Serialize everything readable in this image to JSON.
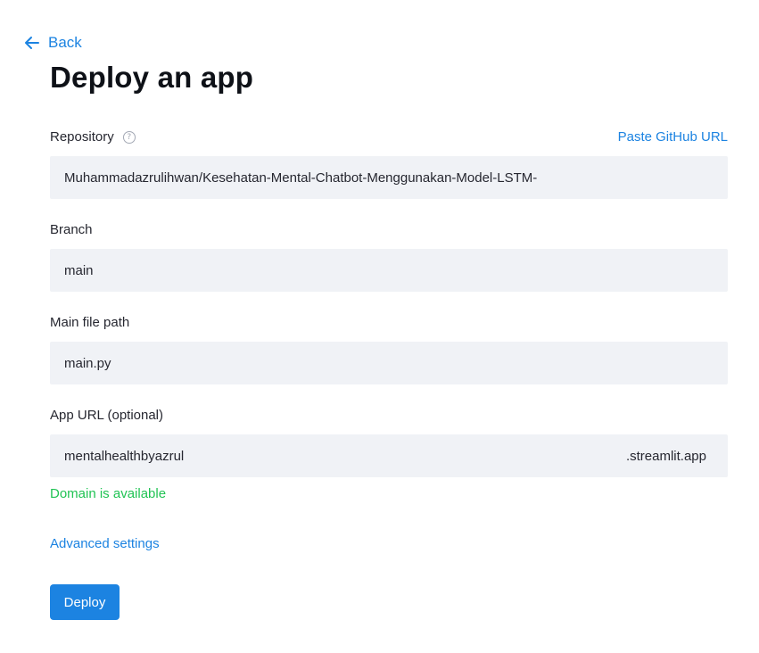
{
  "nav": {
    "back_label": "Back"
  },
  "page": {
    "title": "Deploy an app"
  },
  "repository": {
    "label": "Repository",
    "help_icon": "question-circle-icon",
    "paste_link": "Paste GitHub URL",
    "value": "Muhammadazrulihwan/Kesehatan-Mental-Chatbot-Menggunakan-Model-LSTM-"
  },
  "branch": {
    "label": "Branch",
    "value": "main"
  },
  "main_file": {
    "label": "Main file path",
    "value": "main.py"
  },
  "app_url": {
    "label": "App URL (optional)",
    "value": "mentalhealthbyazrul",
    "suffix": ".streamlit.app",
    "status": "Domain is available"
  },
  "advanced": {
    "label": "Advanced settings"
  },
  "actions": {
    "deploy_label": "Deploy"
  },
  "colors": {
    "accent": "#1c83e1",
    "success": "#21c354",
    "input_bg": "#f0f2f6",
    "text": "#262730"
  }
}
